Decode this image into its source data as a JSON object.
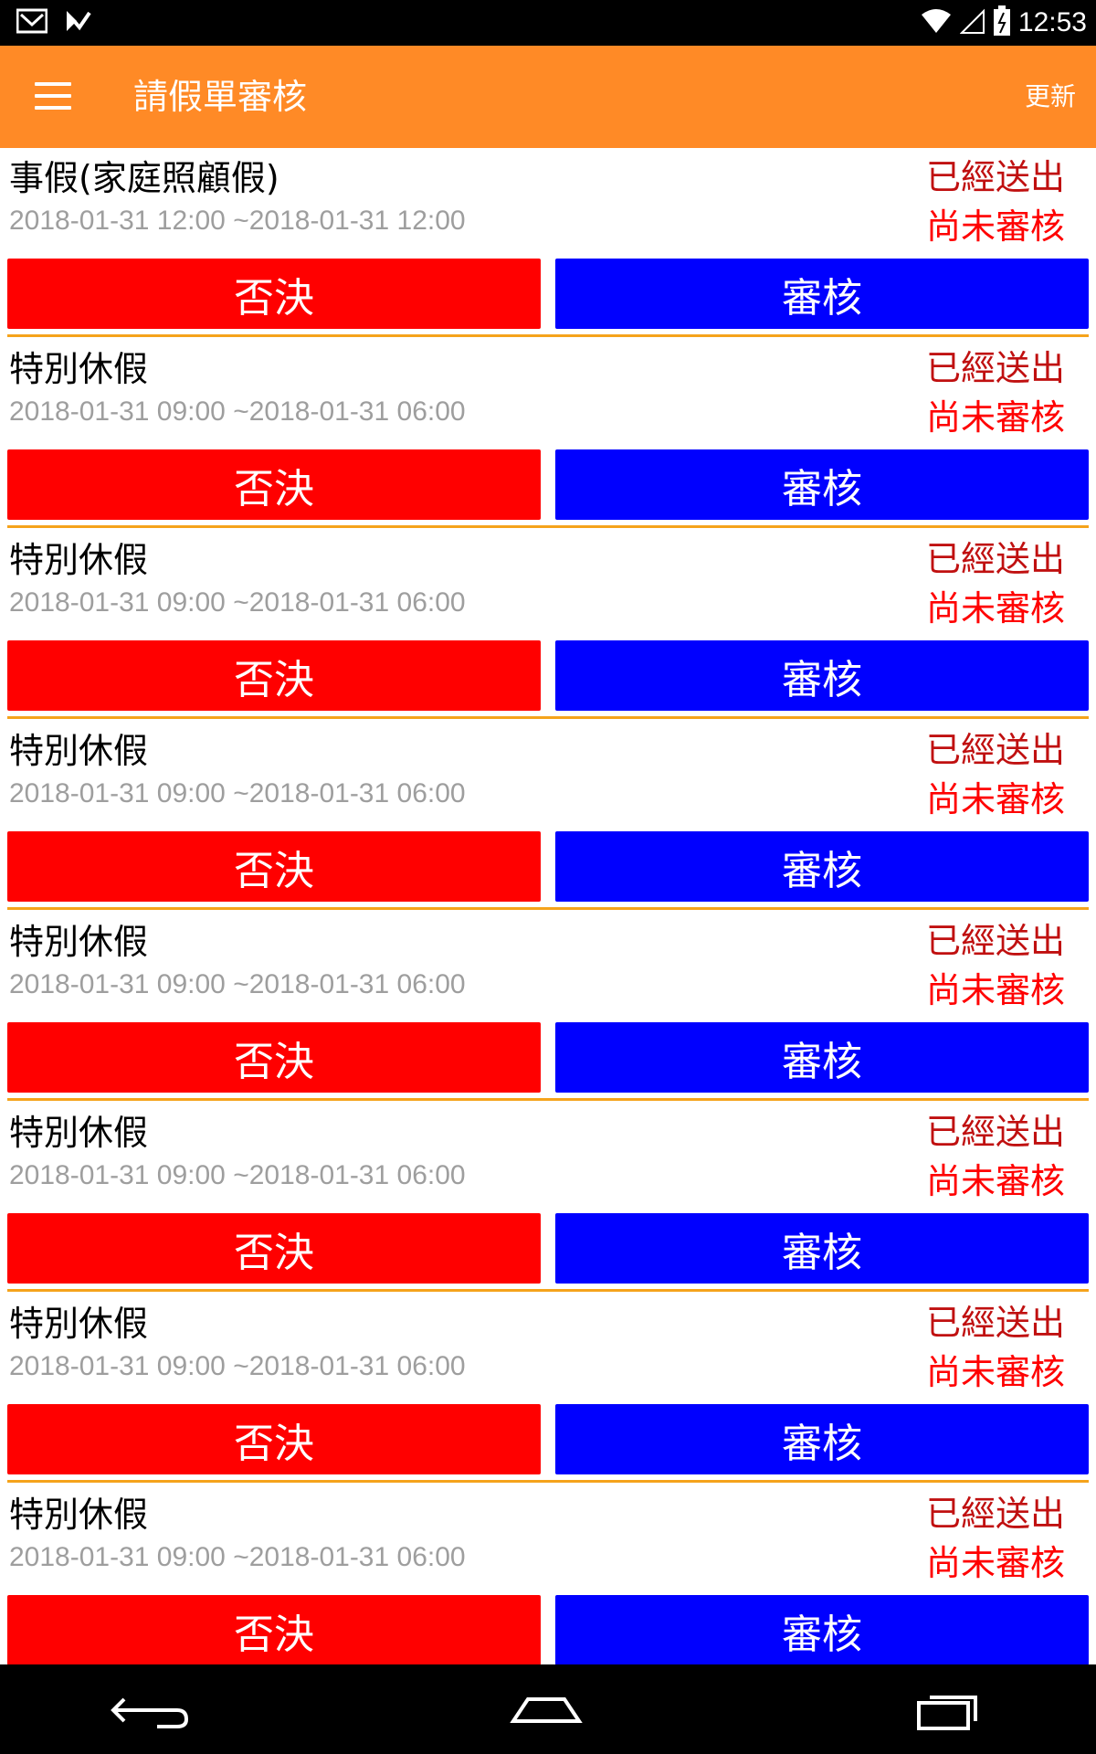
{
  "status_bar": {
    "time": "12:53",
    "icons": [
      "gmail-icon",
      "check-notification-icon",
      "wifi-icon",
      "signal-icon",
      "battery-icon"
    ]
  },
  "app_bar": {
    "title": "請假單審核",
    "refresh_label": "更新",
    "menu_icon": "hamburger-menu-icon"
  },
  "colors": {
    "app_bar": "#ff8a26",
    "reject_button": "#ff0000",
    "approve_button": "#0000ff",
    "divider": "#f5a31b",
    "status_sent": "#c01010",
    "status_pending": "#ff0000",
    "date_text": "#9e9e9e"
  },
  "items": [
    {
      "title": "事假(家庭照顧假)",
      "date_range": "2018-01-31 12:00 ~2018-01-31 12:00",
      "status_sent": "已經送出",
      "status_review": "尚未審核",
      "reject_label": "否決",
      "approve_label": "審核"
    },
    {
      "title": "特別休假",
      "date_range": "2018-01-31 09:00 ~2018-01-31 06:00",
      "status_sent": "已經送出",
      "status_review": "尚未審核",
      "reject_label": "否決",
      "approve_label": "審核"
    },
    {
      "title": "特別休假",
      "date_range": "2018-01-31 09:00 ~2018-01-31 06:00",
      "status_sent": "已經送出",
      "status_review": "尚未審核",
      "reject_label": "否決",
      "approve_label": "審核"
    },
    {
      "title": "特別休假",
      "date_range": "2018-01-31 09:00 ~2018-01-31 06:00",
      "status_sent": "已經送出",
      "status_review": "尚未審核",
      "reject_label": "否決",
      "approve_label": "審核"
    },
    {
      "title": "特別休假",
      "date_range": "2018-01-31 09:00 ~2018-01-31 06:00",
      "status_sent": "已經送出",
      "status_review": "尚未審核",
      "reject_label": "否決",
      "approve_label": "審核"
    },
    {
      "title": "特別休假",
      "date_range": "2018-01-31 09:00 ~2018-01-31 06:00",
      "status_sent": "已經送出",
      "status_review": "尚未審核",
      "reject_label": "否決",
      "approve_label": "審核"
    },
    {
      "title": "特別休假",
      "date_range": "2018-01-31 09:00 ~2018-01-31 06:00",
      "status_sent": "已經送出",
      "status_review": "尚未審核",
      "reject_label": "否決",
      "approve_label": "審核"
    },
    {
      "title": "特別休假",
      "date_range": "2018-01-31 09:00 ~2018-01-31 06:00",
      "status_sent": "已經送出",
      "status_review": "尚未審核",
      "reject_label": "否決",
      "approve_label": "審核"
    }
  ],
  "nav_bar": {
    "icons": [
      "back-icon",
      "home-icon",
      "recents-icon"
    ]
  }
}
